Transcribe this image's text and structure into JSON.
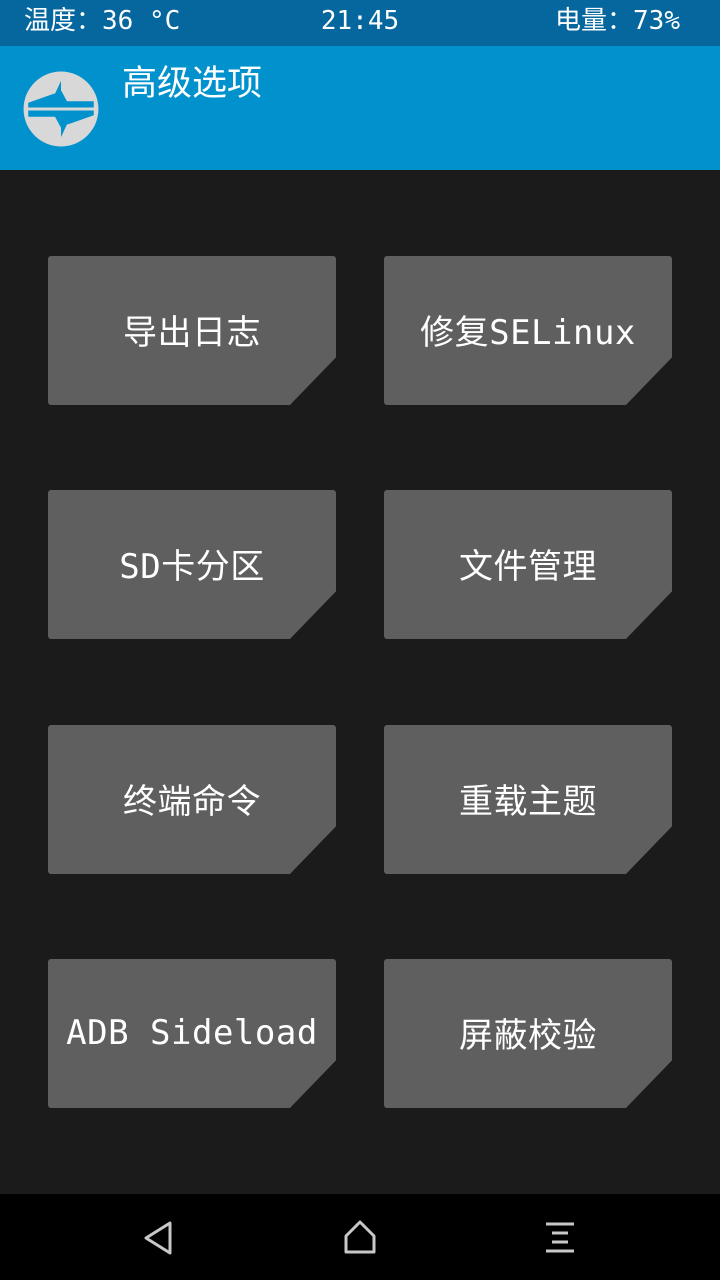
{
  "status_bar": {
    "temperature": "温度：36 °C",
    "time": "21:45",
    "battery": "电量：73%"
  },
  "header": {
    "title": "高级选项",
    "logo_icon": "twrp-logo-icon"
  },
  "buttons": [
    {
      "label": "导出日志"
    },
    {
      "label": "修复SELinux"
    },
    {
      "label": "SD卡分区"
    },
    {
      "label": "文件管理"
    },
    {
      "label": "终端命令"
    },
    {
      "label": "重载主题"
    },
    {
      "label": "ADB Sideload"
    },
    {
      "label": "屏蔽校验"
    }
  ],
  "nav_bar": {
    "icons": [
      "back-icon",
      "home-icon",
      "menu-icon"
    ]
  },
  "colors": {
    "status_bar": "#05679d",
    "header": "#0192cd",
    "background": "#1b1b1b",
    "button": "#5f5f5f",
    "nav_bar": "#000000",
    "text": "#ffffff"
  }
}
